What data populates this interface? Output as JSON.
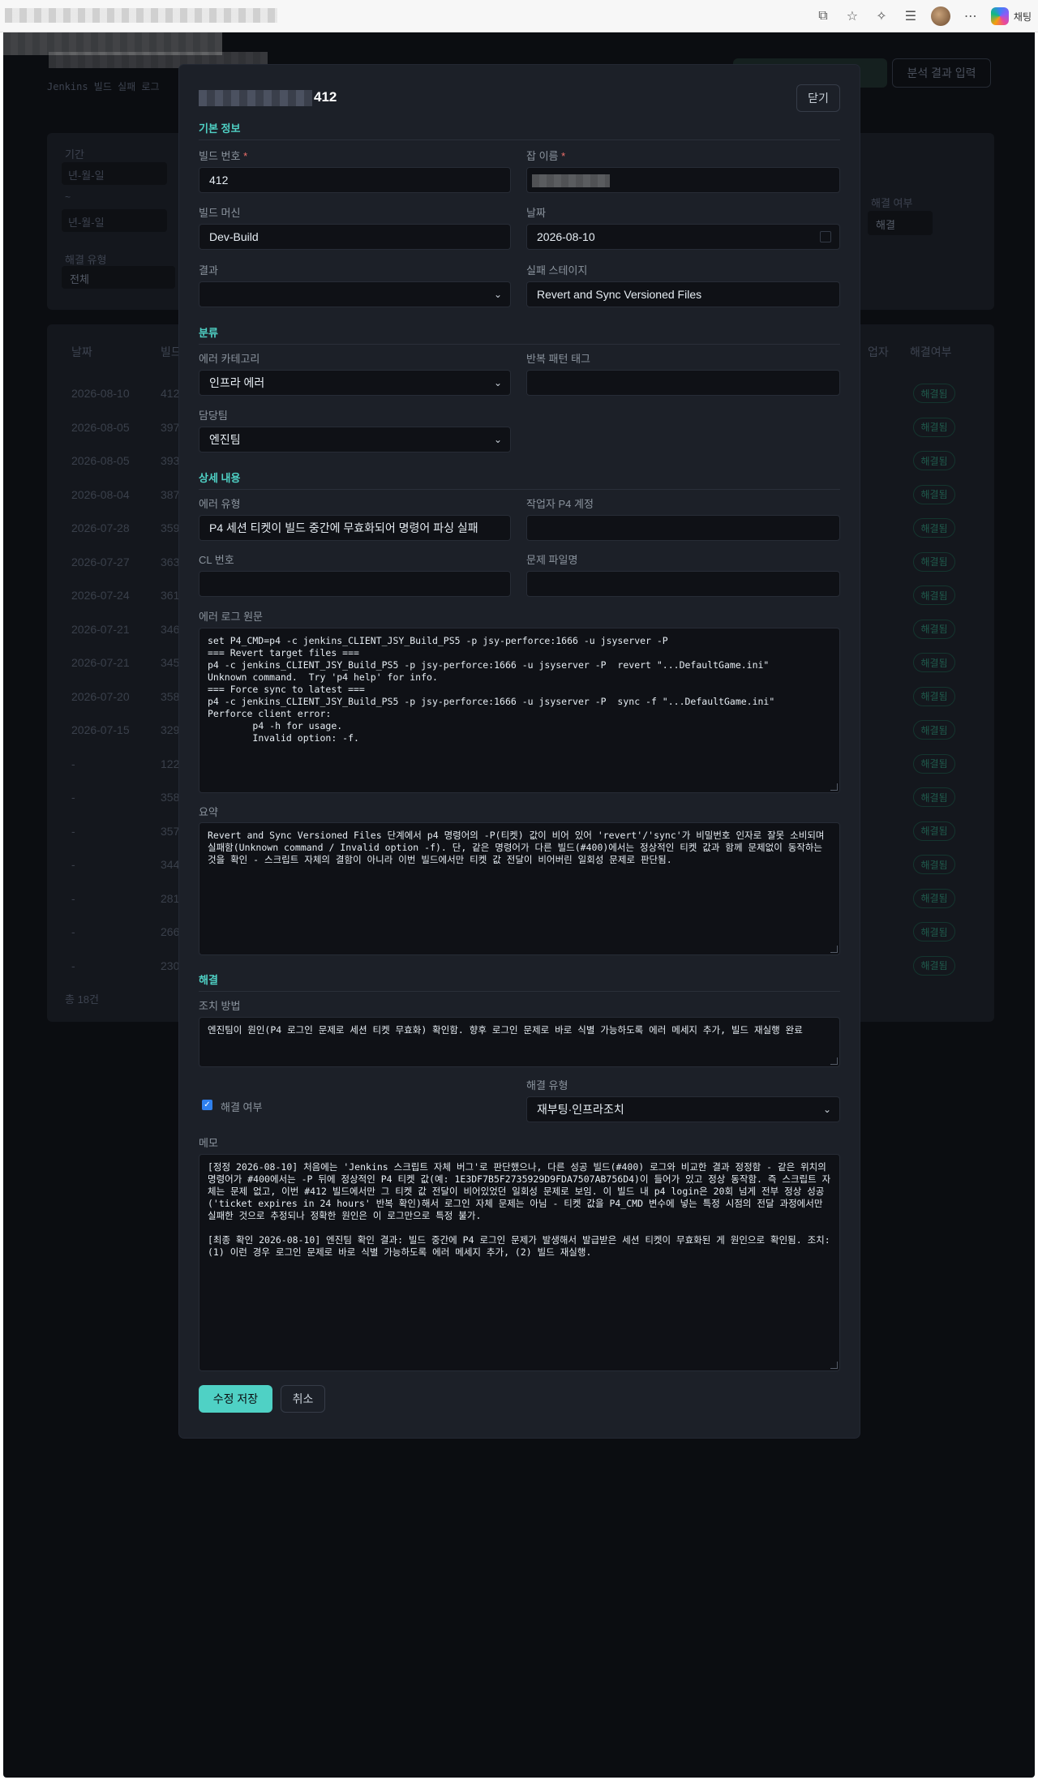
{
  "browser": {
    "copilot_label": "채팅"
  },
  "background": {
    "subtitle": "Jenkins 빌드 실패 로그",
    "analysis_button": "분석 결과 입력",
    "register_button_partial": "록",
    "filter": {
      "period_label": "기간",
      "date_placeholder": "년-월-일",
      "tilde": "~",
      "resolution_type_label": "해결 유형",
      "resolution_type_value": "전체",
      "resolved_label": "해결 여부",
      "resolved_value": "해결"
    },
    "table": {
      "header_date": "날짜",
      "header_build": "빌드",
      "header_worker": "업자",
      "header_resolved": "해결여부",
      "rows": [
        {
          "date": "2026-08-10",
          "build": "412",
          "badge": "해결됨"
        },
        {
          "date": "2026-08-05",
          "build": "397",
          "badge": "해결됨"
        },
        {
          "date": "2026-08-05",
          "build": "393",
          "badge": "해결됨"
        },
        {
          "date": "2026-08-04",
          "build": "387",
          "badge": "해결됨"
        },
        {
          "date": "2026-07-28",
          "build": "359",
          "badge": "해결됨"
        },
        {
          "date": "2026-07-27",
          "build": "363",
          "badge": "해결됨"
        },
        {
          "date": "2026-07-24",
          "build": "361",
          "badge": "해결됨"
        },
        {
          "date": "2026-07-21",
          "build": "346",
          "badge": "해결됨"
        },
        {
          "date": "2026-07-21",
          "build": "345",
          "badge": "해결됨"
        },
        {
          "date": "2026-07-20",
          "build": "358",
          "badge": "해결됨"
        },
        {
          "date": "2026-07-15",
          "build": "329",
          "badge": "해결됨"
        },
        {
          "date": "-",
          "build": "1228",
          "badge": "해결됨"
        },
        {
          "date": "-",
          "build": "358",
          "badge": "해결됨"
        },
        {
          "date": "-",
          "build": "357",
          "badge": "해결됨"
        },
        {
          "date": "-",
          "build": "344",
          "badge": "해결됨"
        },
        {
          "date": "-",
          "build": "281",
          "badge": "해결됨"
        },
        {
          "date": "-",
          "build": "266",
          "badge": "해결됨"
        },
        {
          "date": "-",
          "build": "230",
          "badge": "해결됨"
        }
      ],
      "total": "총 18건"
    }
  },
  "modal": {
    "title_suffix": "412",
    "close": "닫기",
    "sections": {
      "basic": "기본 정보",
      "classification": "분류",
      "details": "상세 내용",
      "resolution": "해결"
    },
    "labels": {
      "build_number": "빌드 번호",
      "job_name": "잡 이름",
      "build_machine": "빌드 머신",
      "date": "날짜",
      "result": "결과",
      "failed_stage": "실패 스테이지",
      "error_category": "에러 카테고리",
      "pattern_tag": "반복 패턴 태그",
      "owner": "담당팀",
      "error_type": "에러 유형",
      "p4_account": "작업자 P4 계정",
      "cl_number": "CL 번호",
      "problem_file": "문제 파일명",
      "error_log": "에러 로그 원문",
      "summary": "요약",
      "action": "조치 방법",
      "resolved": "해결 여부",
      "resolution_type": "해결 유형",
      "memo": "메모",
      "required_mark": "*"
    },
    "values": {
      "build_number": "412",
      "build_machine": "Dev-Build",
      "date": "2026-08-10",
      "result": "",
      "failed_stage": "Revert and Sync Versioned Files",
      "error_category": "인프라 에러",
      "pattern_tag": "",
      "owner": "엔진팀",
      "error_type": "P4 세션 티켓이 빌드 중간에 무효화되어 명령어 파싱 실패",
      "p4_account": "",
      "cl_number": "",
      "problem_file": "",
      "resolved": true,
      "resolution_type": "재부팅·인프라조치",
      "error_log": "set P4_CMD=p4 -c jenkins_CLIENT_JSY_Build_PS5 -p jsy-perforce:1666 -u jsyserver -P\n=== Revert target files ===\np4 -c jenkins_CLIENT_JSY_Build_PS5 -p jsy-perforce:1666 -u jsyserver -P  revert \"...DefaultGame.ini\"\nUnknown command.  Try 'p4 help' for info.\n=== Force sync to latest ===\np4 -c jenkins_CLIENT_JSY_Build_PS5 -p jsy-perforce:1666 -u jsyserver -P  sync -f \"...DefaultGame.ini\"\nPerforce client error:\n        p4 -h for usage.\n        Invalid option: -f.",
      "summary": "Revert and Sync Versioned Files 단계에서 p4 명령어의 -P(티켓) 값이 비어 있어 'revert'/'sync'가 비밀번호 인자로 잘못 소비되며 실패함(Unknown command / Invalid option -f). 단, 같은 명령어가 다른 빌드(#400)에서는 정상적인 티켓 값과 함께 문제없이 동작하는 것을 확인 - 스크립트 자체의 결함이 아니라 이번 빌드에서만 티켓 값 전달이 비어버린 일회성 문제로 판단됨.",
      "action": "엔진팀이 원인(P4 로그인 문제로 세션 티켓 무효화) 확인함. 향후 로그인 문제로 바로 식별 가능하도록 에러 메세지 추가, 빌드 재실행 완료",
      "memo": "[정정 2026-08-10] 처음에는 'Jenkins 스크립트 자체 버그'로 판단했으나, 다른 성공 빌드(#400) 로그와 비교한 결과 정정함 - 같은 위치의 명령어가 #400에서는 -P 뒤에 정상적인 P4 티켓 값(예: 1E3DF7B5F2735929D9FDA7507AB756D4)이 들어가 있고 정상 동작함. 즉 스크립트 자체는 문제 없고, 이번 #412 빌드에서만 그 티켓 값 전달이 비어있었던 일회성 문제로 보임. 이 빌드 내 p4 login은 20회 넘게 전부 정상 성공('ticket expires in 24 hours' 반복 확인)해서 로그인 자체 문제는 아님 - 티켓 값을 P4_CMD 변수에 넣는 특정 시점의 전달 과정에서만 실패한 것으로 추정되나 정확한 원인은 이 로그만으로 특정 불가.\n\n[최종 확인 2026-08-10] 엔진팀 확인 결과: 빌드 중간에 P4 로그인 문제가 발생해서 발급받은 세션 티켓이 무효화된 게 원인으로 확인됨. 조치: (1) 이런 경우 로그인 문제로 바로 식별 가능하도록 에러 메세지 추가, (2) 빌드 재실행."
    },
    "buttons": {
      "save": "수정 저장",
      "cancel": "취소"
    }
  }
}
